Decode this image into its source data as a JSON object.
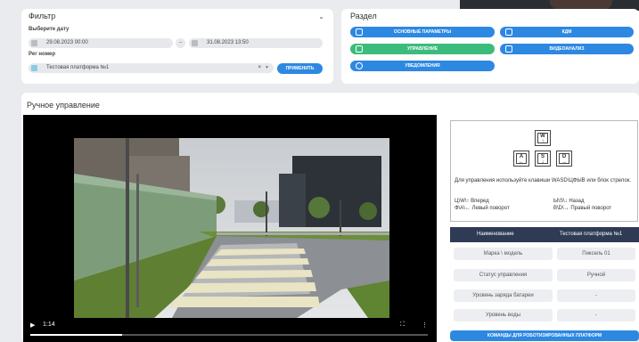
{
  "filter": {
    "title": "Фильтр",
    "date_label": "Выберите дату",
    "date_from": "29.08.2023 00:00",
    "date_separator": "–",
    "date_to": "31.08.2023 13:50",
    "reg_label": "Рег номер",
    "reg_value": "Тестовая платформа №1",
    "clear": "×",
    "apply_label": "ПРИМЕНИТЬ"
  },
  "section": {
    "title": "Раздел",
    "buttons": [
      {
        "label": "ОСНОВНЫЕ ПАРАМЕТРЫ",
        "icon": "sliders-icon",
        "color": "#2d88e2"
      },
      {
        "label": "КДМ",
        "icon": "car-icon",
        "color": "#2d88e2"
      },
      {
        "label": "УПРАВЛЕНИЕ",
        "icon": "joystick-icon",
        "color": "#3cbc7c"
      },
      {
        "label": "ВИДЕОАНАЛИЗ",
        "icon": "video-icon",
        "color": "#2d88e2"
      },
      {
        "label": "УВЕДОМЛЕНИЯ",
        "icon": "bell-icon",
        "color": "#2d88e2"
      }
    ]
  },
  "manual": {
    "title": "Ручное управление",
    "video": {
      "time": "1:14",
      "progress": 0.23
    },
    "keys": {
      "w": "W",
      "a": "A",
      "s": "S",
      "d": "D",
      "instructions": "Для управления используйте клавиши WASD\\ЦФЫВ или блок стрелок.",
      "forward": "Ц\\W\\↑ Вперед",
      "back": "Ы\\S\\↓ Назад",
      "left": "Ф\\A\\← Левый поворот",
      "right": "В\\D\\→ Правый поворот"
    },
    "table": {
      "header_name": "Наименование",
      "header_value": "Тестовая платформа №1",
      "rows": [
        {
          "label": "Марка \\ модель",
          "value": "Пиксель 01"
        },
        {
          "label": "Статус управления",
          "value": "Ручной"
        },
        {
          "label": "Уровень заряда батареи",
          "value": "-"
        },
        {
          "label": "Уровень воды",
          "value": "-"
        }
      ]
    },
    "commands_label": "КОМАНДЫ ДЛЯ РОБОТИЗИРОВАННЫХ ПЛАТФОРМ"
  }
}
